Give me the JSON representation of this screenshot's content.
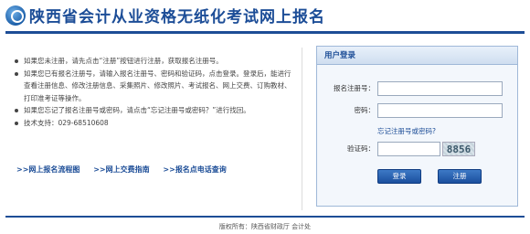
{
  "header": {
    "title": "陕西省会计从业资格无纸化考试网上报名"
  },
  "notices": [
    "如果您未注册，请先点击“注册”按钮进行注册，获取报名注册号。",
    "如果您已有报名注册号，请输入报名注册号、密码和验证码，点击登录。登录后，能进行查看注册信息、修改注册信息、采集照片、修改照片、考试报名、网上交费、订购教材、打印准考证等操作。",
    "如果您忘记了报名注册号或密码，请点击“忘记注册号或密码？”进行找回。",
    "技术支持：029-68510608"
  ],
  "links": [
    ">>网上报名流程图",
    ">>网上交费指南",
    ">>报名点电话查询"
  ],
  "login": {
    "title": "用户登录",
    "reg_label": "报名注册号：",
    "reg_value": "",
    "pwd_label": "密码：",
    "pwd_value": "",
    "forgot": "忘记注册号或密码?",
    "captcha_label": "验证码：",
    "captcha_value": "",
    "captcha_text": "8856",
    "login_button": "登录",
    "register_button": "注册"
  },
  "footer": {
    "text": "版权所有：陕西省财政厅 会计处"
  },
  "colors": {
    "brand": "#1c4d97",
    "rule": "#1d4d96",
    "button": "#1b4f9e"
  }
}
